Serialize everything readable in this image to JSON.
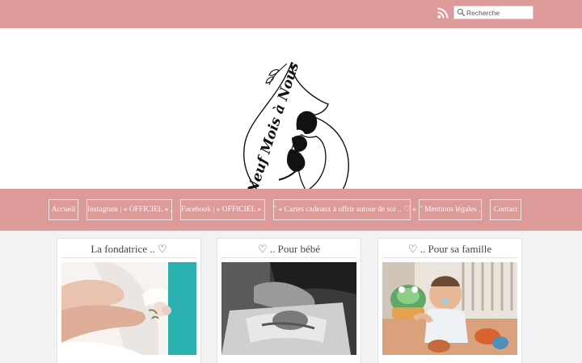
{
  "topbar": {
    "rss_icon": "rss-icon",
    "search": {
      "placeholder": "Recherche",
      "icon": "search-icon"
    }
  },
  "header": {
    "logo_text": "Neuf Mois à Nous"
  },
  "nav": {
    "items": [
      {
        "label": "Accueil"
      },
      {
        "label": "Instagram | « OFFICIEL » ."
      },
      {
        "label": "Facebook | « OFFICIEL » ."
      },
      {
        "label": "˚ « Cartes cadeaux à offrir autour de soi .. ♡ » ."
      },
      {
        "label": "˚ Mentions légales ."
      },
      {
        "label": "Contact"
      }
    ]
  },
  "cards": [
    {
      "title": "La fondatrice .. ♡"
    },
    {
      "title": "♡ .. Pour bébé"
    },
    {
      "title": "♡ .. Pour sa famille"
    }
  ],
  "colors": {
    "brand_pink": "#dc9a98",
    "page_bg": "#f2f2f2",
    "teal_accent": "#2ab0ae"
  }
}
